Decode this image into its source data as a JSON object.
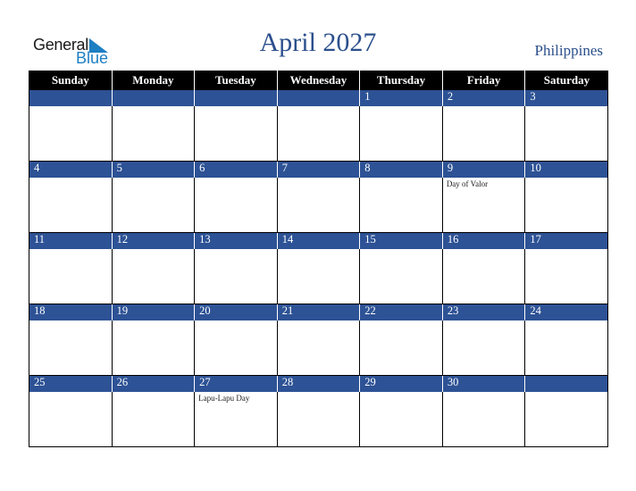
{
  "logo": {
    "line1": "General",
    "line2": "Blue"
  },
  "header": {
    "title": "April 2027",
    "country": "Philippines"
  },
  "colors": {
    "band": "#2d5295",
    "header_bg": "#000000",
    "title": "#2b4f8c",
    "logo_blue": "#1e7fc3"
  },
  "weekdays": [
    "Sunday",
    "Monday",
    "Tuesday",
    "Wednesday",
    "Thursday",
    "Friday",
    "Saturday"
  ],
  "weeks": [
    {
      "days": [
        "",
        "",
        "",
        "",
        "1",
        "2",
        "3"
      ],
      "events": [
        "",
        "",
        "",
        "",
        "",
        "",
        ""
      ]
    },
    {
      "days": [
        "4",
        "5",
        "6",
        "7",
        "8",
        "9",
        "10"
      ],
      "events": [
        "",
        "",
        "",
        "",
        "",
        "Day of Valor",
        ""
      ]
    },
    {
      "days": [
        "11",
        "12",
        "13",
        "14",
        "15",
        "16",
        "17"
      ],
      "events": [
        "",
        "",
        "",
        "",
        "",
        "",
        ""
      ]
    },
    {
      "days": [
        "18",
        "19",
        "20",
        "21",
        "22",
        "23",
        "24"
      ],
      "events": [
        "",
        "",
        "",
        "",
        "",
        "",
        ""
      ]
    },
    {
      "days": [
        "25",
        "26",
        "27",
        "28",
        "29",
        "30",
        ""
      ],
      "events": [
        "",
        "",
        "Lapu-Lapu Day",
        "",
        "",
        "",
        ""
      ]
    }
  ]
}
